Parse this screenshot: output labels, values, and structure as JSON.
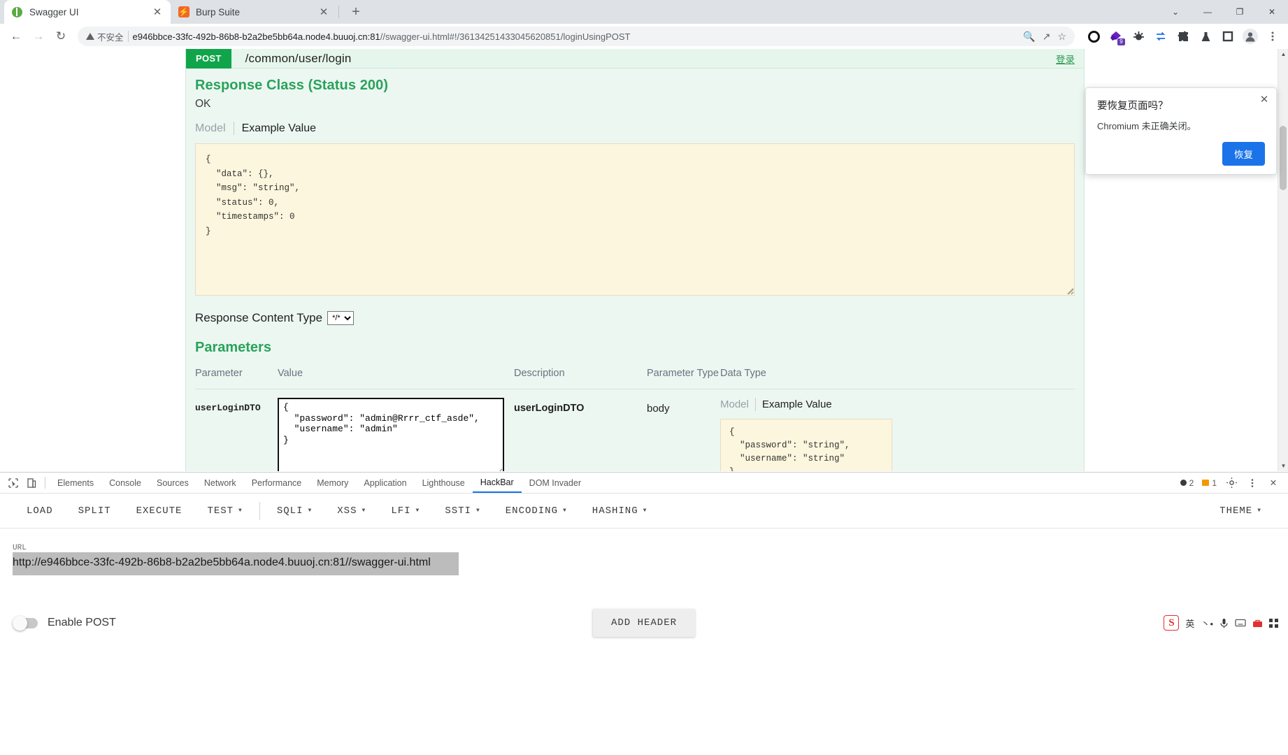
{
  "browser": {
    "tabs": [
      {
        "title": "Swagger UI",
        "favicon": "swagger-favicon",
        "active": true
      },
      {
        "title": "Burp Suite",
        "favicon": "burp-favicon",
        "active": false
      }
    ],
    "new_tab_label": "+",
    "window_controls": {
      "minimize": "—",
      "maximize": "❐",
      "close": "✕",
      "more": "⌄"
    },
    "nav": {
      "back": "←",
      "forward": "→",
      "reload": "↻"
    },
    "omnibox": {
      "security_label": "不安全",
      "url_host": "e946bbce-33fc-492b-86b8-b2a2be5bb64a.node4.buuoj.cn:81",
      "url_rest": "//swagger-ui.html#!/36134251433045620851/loginUsingPOST",
      "icons": [
        "zoom-icon",
        "share-icon",
        "bookmark-star-icon"
      ]
    },
    "extensions": [
      "opera-o-icon",
      "hackbar-extension-icon",
      "bug-extension-icon",
      "proxy-swap-icon",
      "puzzle-extensions-icon",
      "flask-lab-icon",
      "square-extension-icon",
      "profile-avatar-icon",
      "chrome-menu-icon"
    ],
    "extension_badge": "9"
  },
  "restore_bubble": {
    "title": "要恢复页面吗？",
    "body": "Chromium 未正确关闭。",
    "button": "恢复",
    "close": "✕"
  },
  "swagger": {
    "method": "POST",
    "path": "/common/user/login",
    "login_link": "登录",
    "response_class_title": "Response Class (Status 200)",
    "response_ok": "OK",
    "tabs": {
      "model": "Model",
      "example": "Example Value"
    },
    "example_value_json": "{\n  \"data\": {},\n  \"msg\": \"string\",\n  \"status\": 0,\n  \"timestamps\": 0\n}",
    "response_content_type_label": "Response Content Type",
    "response_content_type_value": "*/*",
    "response_content_type_options": [
      "*/*"
    ],
    "parameters_title": "Parameters",
    "table_headers": [
      "Parameter",
      "Value",
      "Description",
      "Parameter Type",
      "Data Type"
    ],
    "rows": [
      {
        "name": "userLoginDTO",
        "value": "{\n  \"password\": \"admin@Rrrr_ctf_asde\",\n  \"username\": \"admin\"\n}",
        "description": "userLoginDTO",
        "param_type": "body",
        "data_type_tabs": {
          "model": "Model",
          "example": "Example Value"
        },
        "data_type_example": "{\n  \"password\": \"string\",\n  \"username\": \"string\"\n}"
      }
    ]
  },
  "devtools": {
    "icons": {
      "inspect": "inspect-element-icon",
      "device": "device-toolbar-icon",
      "settings": "gear-icon",
      "more": "kebab-menu-icon",
      "close": "close-icon"
    },
    "tabs": [
      {
        "label": "Elements",
        "selected": false
      },
      {
        "label": "Console",
        "selected": false
      },
      {
        "label": "Sources",
        "selected": false
      },
      {
        "label": "Network",
        "selected": false
      },
      {
        "label": "Performance",
        "selected": false
      },
      {
        "label": "Memory",
        "selected": false
      },
      {
        "label": "Application",
        "selected": false
      },
      {
        "label": "Lighthouse",
        "selected": false
      },
      {
        "label": "HackBar",
        "selected": true
      },
      {
        "label": "DOM Invader",
        "selected": false
      }
    ],
    "error_count": "2",
    "warning_count": "1"
  },
  "hackbar": {
    "buttons": [
      {
        "label": "LOAD",
        "caret": false
      },
      {
        "label": "SPLIT",
        "caret": false
      },
      {
        "label": "EXECUTE",
        "caret": false
      },
      {
        "label": "TEST",
        "caret": true
      }
    ],
    "menus": [
      {
        "label": "SQLI",
        "caret": true
      },
      {
        "label": "XSS",
        "caret": true
      },
      {
        "label": "LFI",
        "caret": true
      },
      {
        "label": "SSTI",
        "caret": true
      },
      {
        "label": "ENCODING",
        "caret": true
      },
      {
        "label": "HASHING",
        "caret": true
      }
    ],
    "theme": {
      "label": "THEME",
      "caret": true
    },
    "url_label": "URL",
    "url_value": "http://e946bbce-33fc-492b-86b8-b2a2be5bb64a.node4.buuoj.cn:81//swagger-ui.html",
    "enable_post_label": "Enable POST",
    "enable_post_on": false,
    "add_header_label": "ADD HEADER"
  },
  "tray": {
    "sogou": "S",
    "items": [
      "英",
      "丶•",
      "mic-icon",
      "keyboard-icon",
      "toolbox-icon",
      "grid-icon"
    ]
  }
}
